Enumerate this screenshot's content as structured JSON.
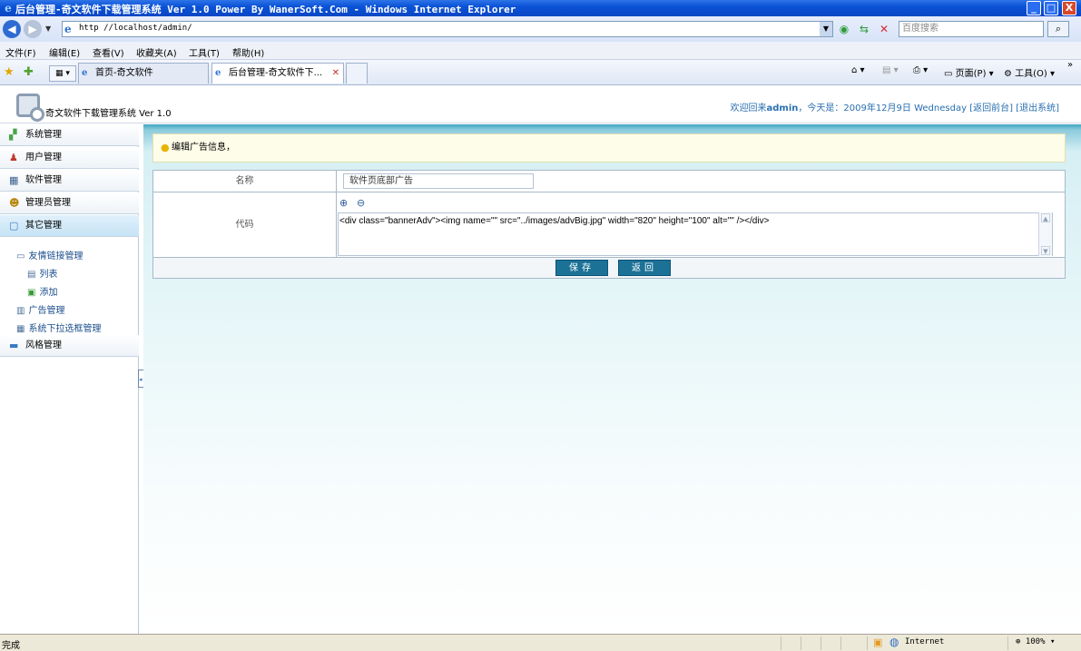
{
  "window": {
    "title": "后台管理-奇文软件下载管理系统 Ver 1.0 Power By WanerSoft.Com - Windows Internet Explorer",
    "min_label": "_",
    "max_label": "□",
    "close_label": "X"
  },
  "address": {
    "url": "http //localhost/admin/",
    "search_placeholder": "百度搜索"
  },
  "menu": [
    "文件(F)",
    "编辑(E)",
    "查看(V)",
    "收藏夹(A)",
    "工具(T)",
    "帮助(H)"
  ],
  "tabs": [
    {
      "label": "首页-奇文软件",
      "active": false
    },
    {
      "label": "后台管理-奇文软件下...",
      "active": true
    }
  ],
  "toolbar": {
    "page_label": "页面(P)",
    "tools_label": "工具(O)"
  },
  "header": {
    "app_title": "奇文软件下载管理系统 Ver 1.0",
    "welcome_prefix": "欢迎回来",
    "user": "admin",
    "date_text": "，今天是：2009年12月9日 Wednesday",
    "link_front": "[返回前台]",
    "link_logout": "[退出系统]"
  },
  "sidebar": {
    "items": [
      {
        "label": "系统管理",
        "icon": "puzzle-icon"
      },
      {
        "label": "用户管理",
        "icon": "users-icon"
      },
      {
        "label": "软件管理",
        "icon": "grid-icon"
      },
      {
        "label": "管理员管理",
        "icon": "admin-icon"
      },
      {
        "label": "其它管理",
        "icon": "window-icon"
      }
    ],
    "sub_items": {
      "links": "友情链接管理",
      "list": "列表",
      "add": "添加",
      "ads": "广告管理",
      "dropdown": "系统下拉选框管理"
    },
    "style_item": "风格管理"
  },
  "main": {
    "notice": "编辑广告信息，",
    "form": {
      "name_label": "名称",
      "name_value": "软件页底部广告",
      "code_label": "代码",
      "code_value": "<div class=\"bannerAdv\"><img name=\"\" src=\"../images/advBig.jpg\" width=\"820\" height=\"100\" alt=\"\" /></div>"
    },
    "buttons": {
      "save": "保存",
      "back": "返回"
    }
  },
  "status": {
    "text": "完成",
    "zone": "Internet",
    "zoom": "100%"
  }
}
